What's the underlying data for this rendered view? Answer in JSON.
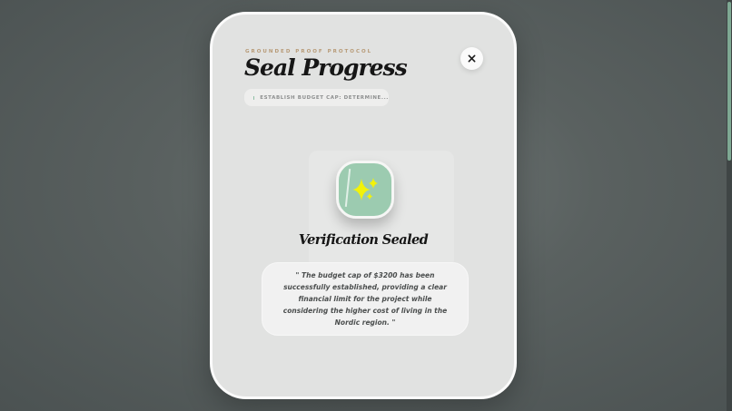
{
  "modal": {
    "eyebrow": "GROUNDED PROOF PROTOCOL",
    "title": "Seal Progress",
    "close_icon": "close-icon",
    "step_pill": {
      "label": "ESTABLISH BUDGET CAP: DETERMINE...",
      "dot_color": "#8cbfa2"
    },
    "seal": {
      "icon": "sparkles-icon",
      "badge_color": "#9ccbb0",
      "sparkle_color": "#f2f20a",
      "heading": "Verification Sealed"
    },
    "quote": {
      "text": "\" The budget cap of $3200 has been successfully established, providing a clear financial limit for the project while considering the higher cost of living in the Nordic region. \""
    }
  },
  "colors": {
    "accent_gold": "#b79a76",
    "card_bg": "#e1e2e1"
  }
}
